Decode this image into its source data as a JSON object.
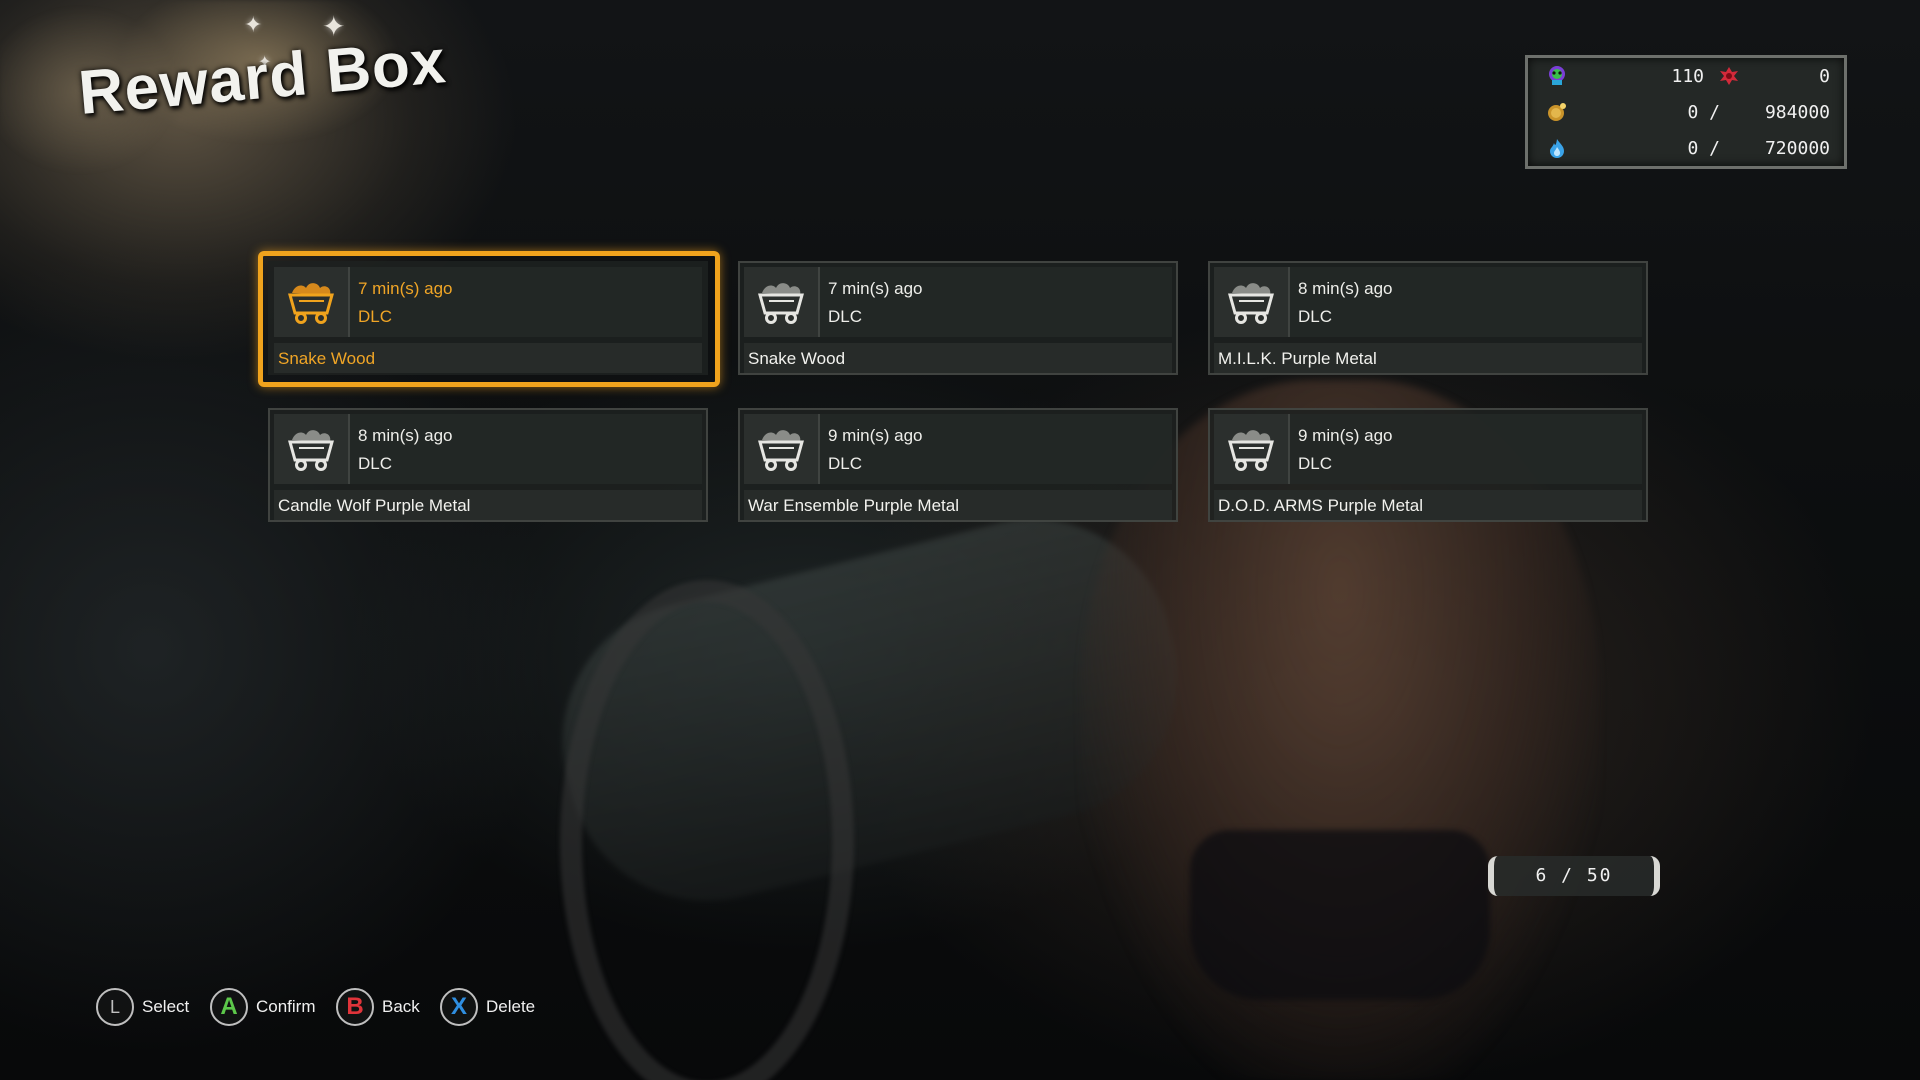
{
  "screen": {
    "title": "Reward Box"
  },
  "currency": {
    "row1": {
      "icon": "ghost-skull-icon",
      "value_a": "110",
      "icon_b": "red-creature-icon",
      "value_b": "0"
    },
    "row2": {
      "icon": "gold-coin-icon",
      "current": "0 /",
      "max": "984000"
    },
    "row3": {
      "icon": "blue-flame-icon",
      "current": "0 /",
      "max": "720000"
    }
  },
  "rewards": [
    {
      "time": "7 min(s) ago",
      "source": "DLC",
      "name": "Snake Wood",
      "icon": "mine-cart-icon",
      "selected": true
    },
    {
      "time": "7 min(s) ago",
      "source": "DLC",
      "name": "Snake Wood",
      "icon": "mine-cart-icon",
      "selected": false
    },
    {
      "time": "8 min(s) ago",
      "source": "DLC",
      "name": "M.I.L.K. Purple Metal",
      "icon": "mine-cart-icon",
      "selected": false
    },
    {
      "time": "8 min(s) ago",
      "source": "DLC",
      "name": "Candle Wolf Purple Metal",
      "icon": "mine-cart-icon",
      "selected": false
    },
    {
      "time": "9 min(s) ago",
      "source": "DLC",
      "name": "War Ensemble Purple Metal",
      "icon": "mine-cart-icon",
      "selected": false
    },
    {
      "time": "9 min(s) ago",
      "source": "DLC",
      "name": "D.O.D. ARMS Purple Metal",
      "icon": "mine-cart-icon",
      "selected": false
    }
  ],
  "page_counter": "6 / 50",
  "button_hints": [
    {
      "button": "L",
      "label": "Select",
      "color": "#bfbfbf"
    },
    {
      "button": "A",
      "label": "Confirm",
      "color": "#5cc84a"
    },
    {
      "button": "B",
      "label": "Back",
      "color": "#e0343a"
    },
    {
      "button": "X",
      "label": "Delete",
      "color": "#2f8ee0"
    }
  ],
  "colors": {
    "accent_selected": "#f0a31d",
    "text_primary": "#eeeeea"
  }
}
